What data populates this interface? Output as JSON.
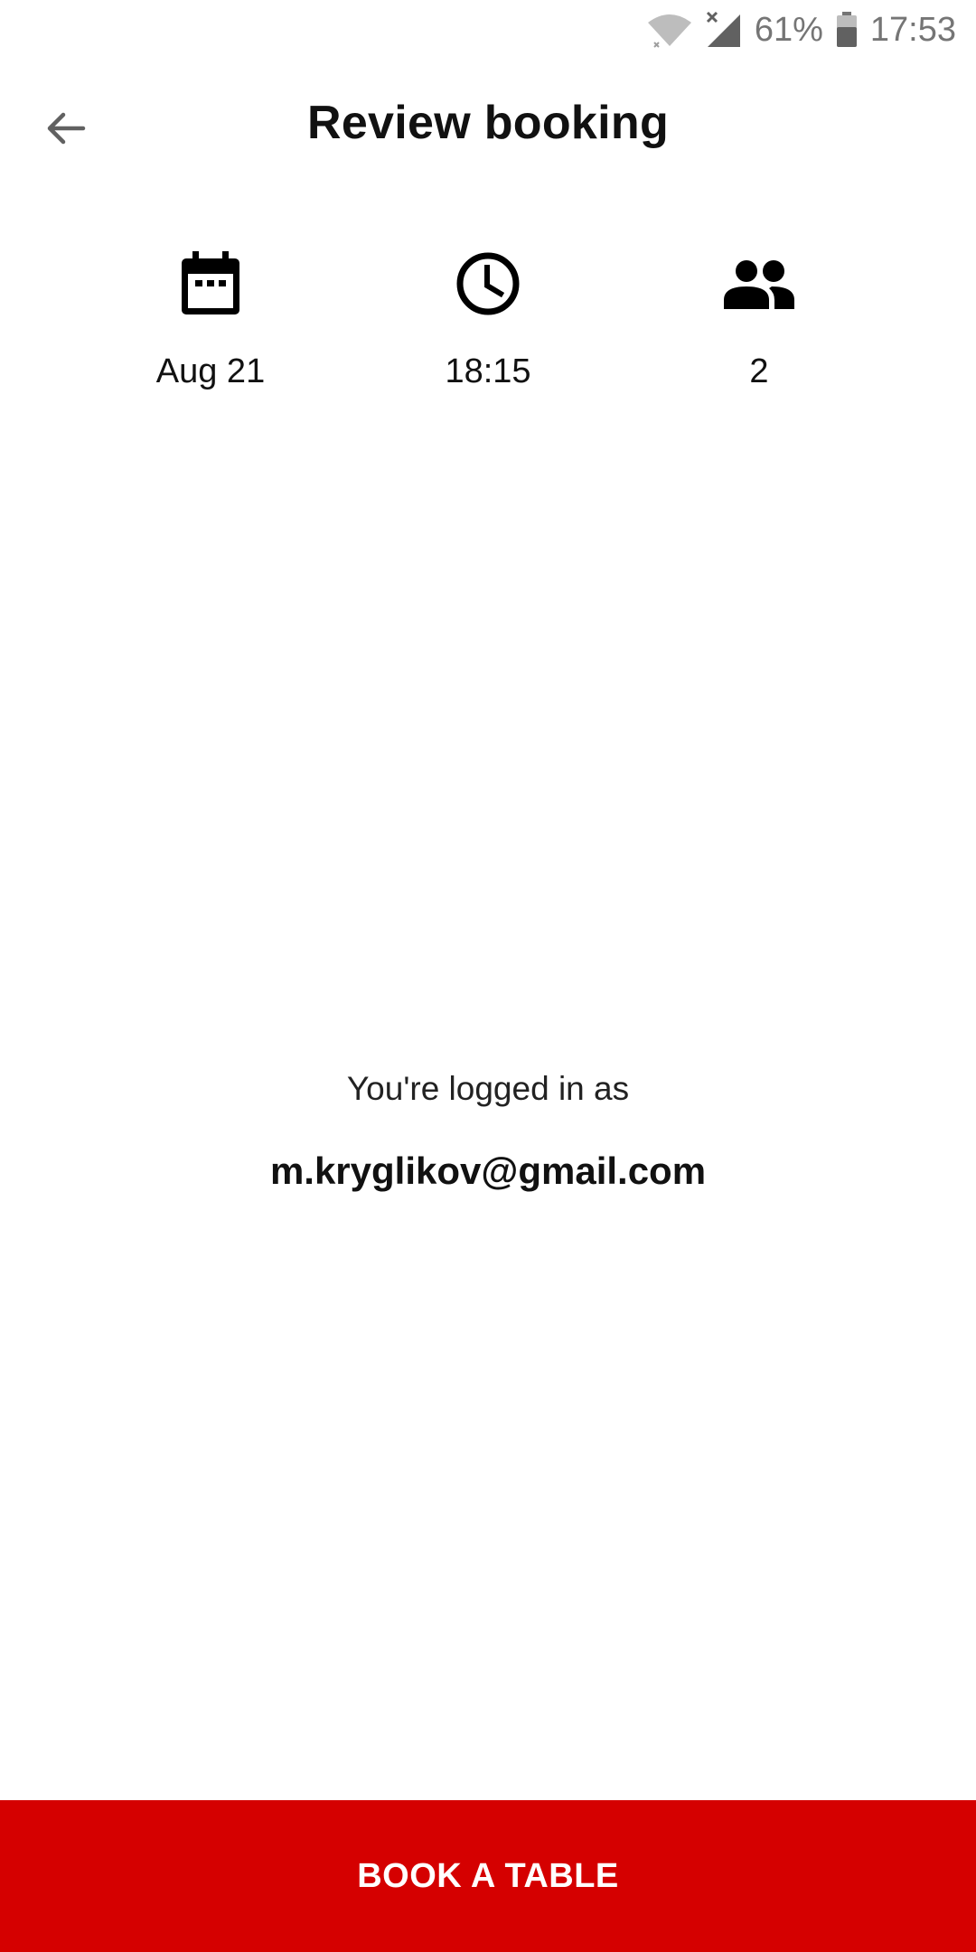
{
  "status_bar": {
    "battery_percent": "61%",
    "time": "17:53",
    "icons": [
      "wifi-icon",
      "signal-icon",
      "battery-icon"
    ]
  },
  "header": {
    "title": "Review booking",
    "back_icon": "arrow-left-icon"
  },
  "summary": {
    "date": {
      "icon": "calendar-icon",
      "value": "Aug 21"
    },
    "time": {
      "icon": "clock-icon",
      "value": "18:15"
    },
    "guests": {
      "icon": "people-icon",
      "value": "2"
    }
  },
  "account": {
    "label": "You're logged in as",
    "email": "m.kryglikov@gmail.com"
  },
  "footer": {
    "book_label": "BOOK A TABLE"
  },
  "colors": {
    "accent": "#d50000",
    "text": "#111111",
    "status": "#757575"
  }
}
